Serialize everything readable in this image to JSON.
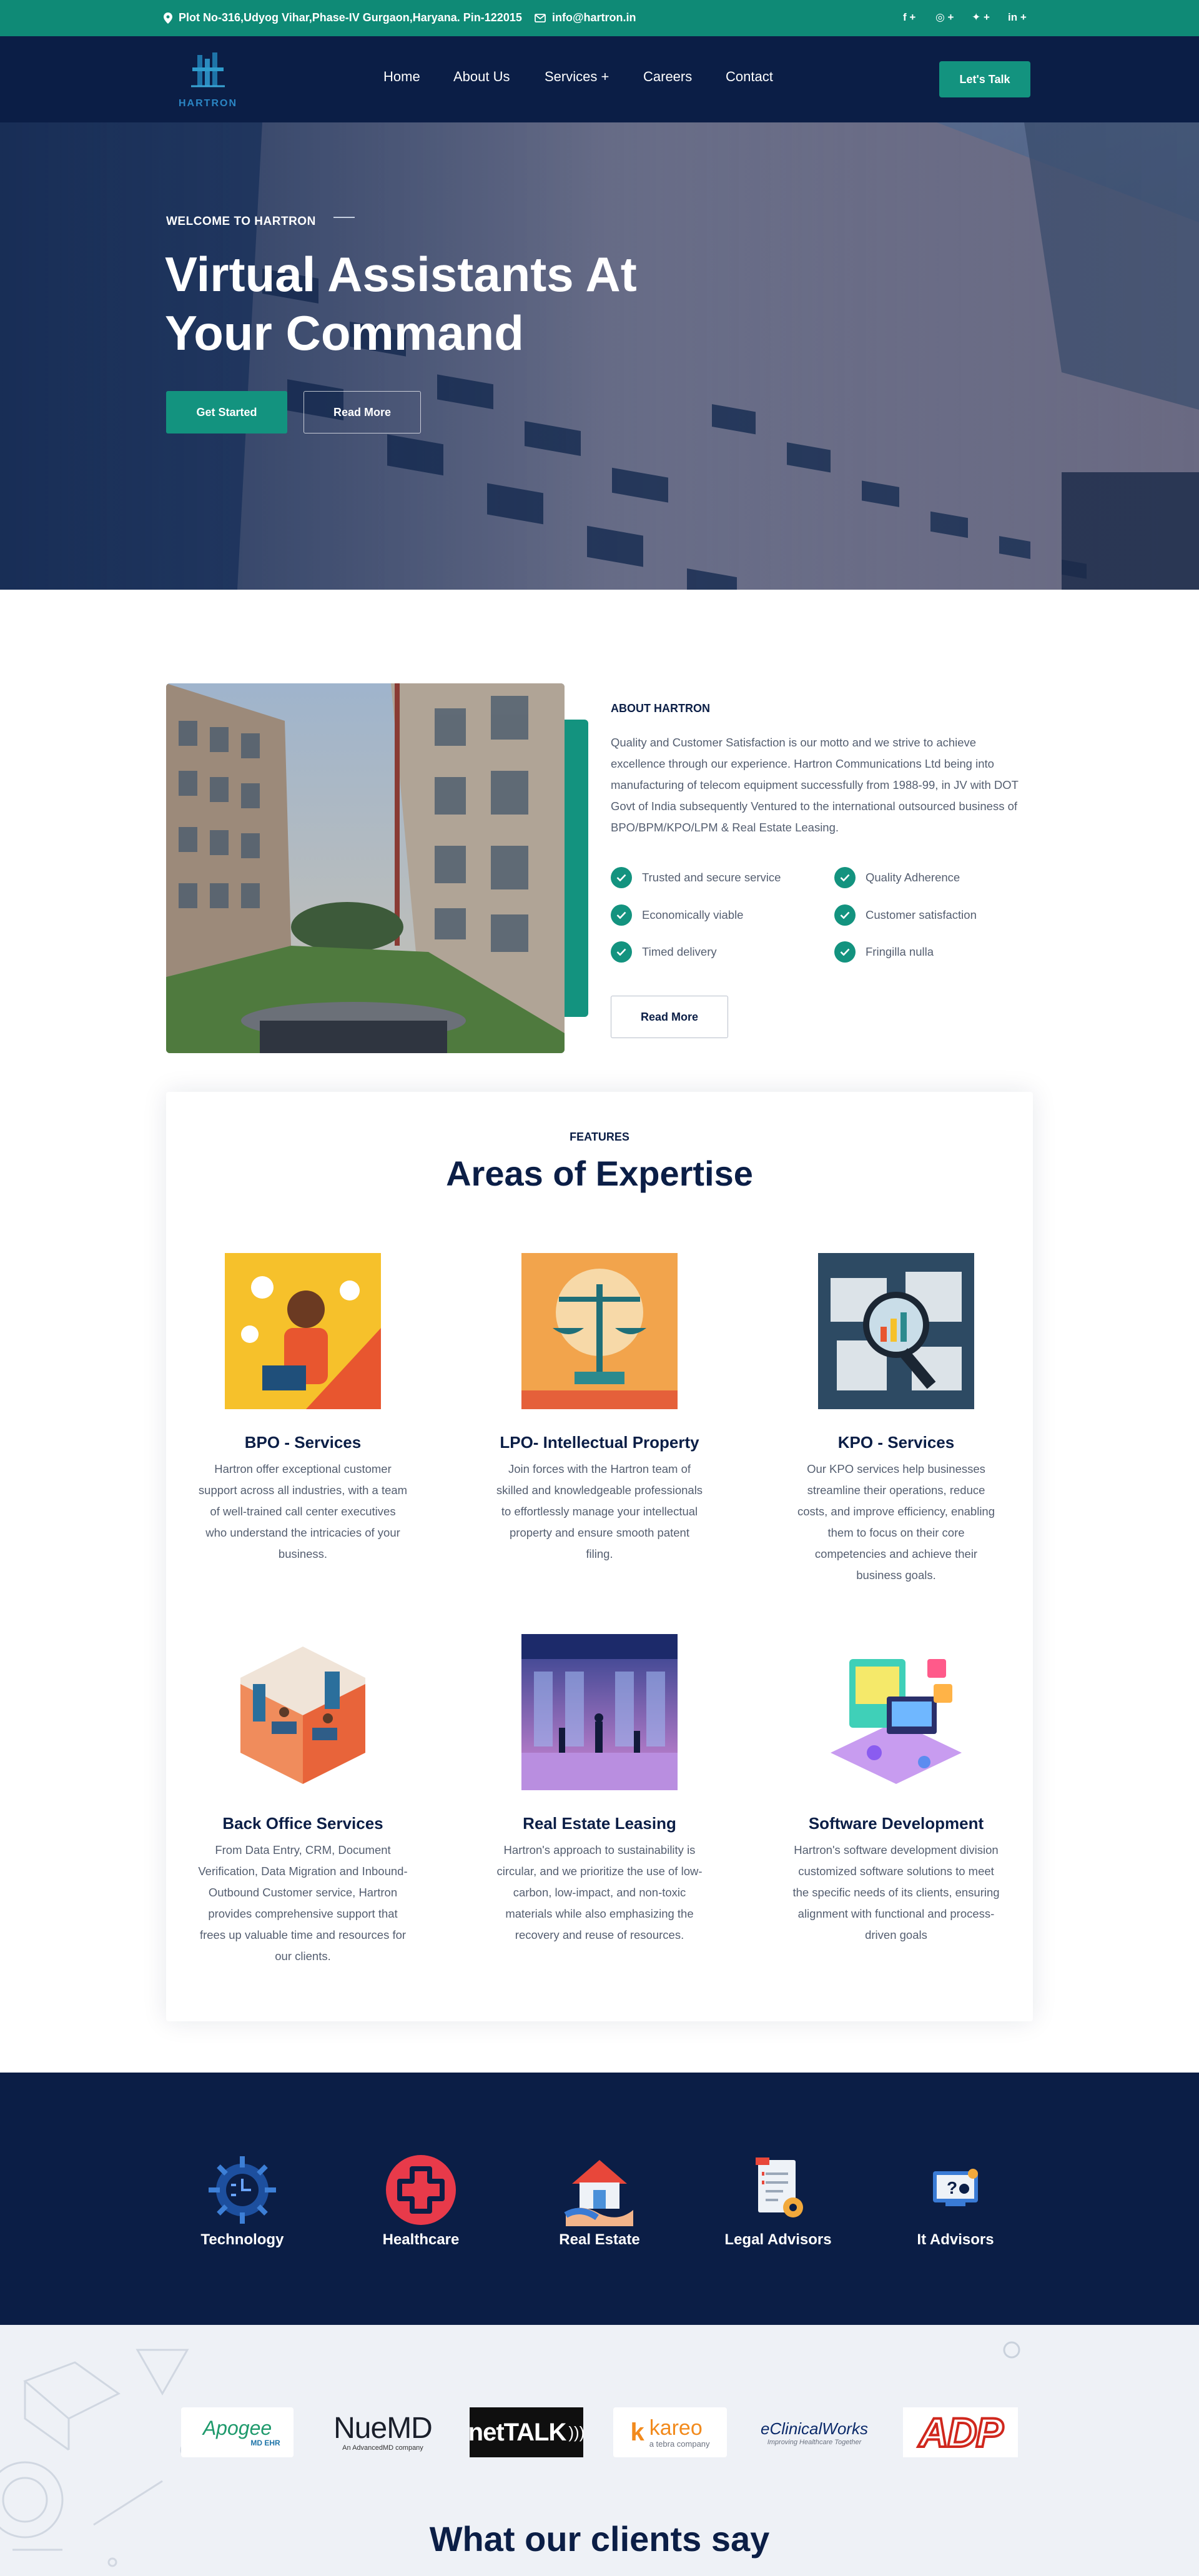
{
  "topbar": {
    "address": "Plot No-316,Udyog Vihar,Phase-IV Gurgaon,Haryana. Pin-122015",
    "email": "info@hartron.in",
    "social": [
      "f +",
      "◎ +",
      "✦ +",
      "in +"
    ]
  },
  "nav": {
    "logo_text": "HARTRON",
    "links": [
      "Home",
      "About Us",
      "Services +",
      "Careers",
      "Contact"
    ],
    "cta": "Let's Talk"
  },
  "hero": {
    "eyebrow": "WELCOME TO HARTRON",
    "title_line1": "Virtual Assistants At",
    "title_line2": "Your Command",
    "btn_primary": "Get Started",
    "btn_secondary": "Read More"
  },
  "about": {
    "label": "ABOUT HARTRON",
    "text": "Quality and Customer Satisfaction is our motto and we strive to achieve excellence through our experience. Hartron Communications Ltd being into manufacturing of telecom equipment successfully from 1988-99, in JV with DOT Govt of India subsequently Ventured to the international outsourced business of BPO/BPM/KPO/LPM & Real Estate Leasing.",
    "checks": [
      "Trusted and secure service",
      "Quality Adherence",
      "Economically viable",
      "Customer satisfaction",
      "Timed delivery",
      "Fringilla nulla"
    ],
    "read_more": "Read More"
  },
  "features": {
    "label": "FEATURES",
    "title": "Areas of Expertise",
    "cards": [
      {
        "title": "BPO - Services",
        "text": "Hartron offer exceptional customer support across all industries, with a team of well-trained call center executives who understand the intricacies of your business."
      },
      {
        "title": "LPO- Intellectual Property",
        "text": "Join forces with the Hartron team of skilled and knowledgeable professionals to effortlessly manage your intellectual property and ensure smooth patent filing."
      },
      {
        "title": "KPO - Services",
        "text": "Our KPO services help businesses streamline their operations, reduce costs, and improve efficiency, enabling them to focus on their core competencies and achieve their business goals."
      },
      {
        "title": "Back Office Services",
        "text": "From Data Entry, CRM, Document Verification, Data Migration and Inbound-Outbound Customer service, Hartron provides comprehensive support that frees up valuable time and resources for our clients."
      },
      {
        "title": "Real Estate Leasing",
        "text": "Hartron's approach to sustainability is circular, and we prioritize the use of low-carbon, low-impact, and non-toxic materials while also emphasizing the recovery and reuse of resources."
      },
      {
        "title": "Software Development",
        "text": "Hartron's software development division customized software solutions to meet the specific needs of its clients, ensuring alignment with functional and process-driven goals"
      }
    ]
  },
  "industries": [
    "Technology",
    "Healthcare",
    "Real Estate",
    "Legal Advisors",
    "It Advisors"
  ],
  "partners": {
    "apogee": "Apogee",
    "apogee_sub": "MD EHR",
    "nuemd": "NueMD",
    "nuemd_sub": "An AdvancedMD company",
    "nettalk": "netTALK",
    "kareo": "kareo",
    "kareo_sub": "a tebra company",
    "ecw": "eClinicalWorks",
    "ecw_sub": "Improving Healthcare Together",
    "adp": "ADP"
  },
  "clients": {
    "title": "What our clients say"
  },
  "colors": {
    "teal": "#13937f",
    "navy": "#0b1e46",
    "topbar": "#0f8a76"
  }
}
